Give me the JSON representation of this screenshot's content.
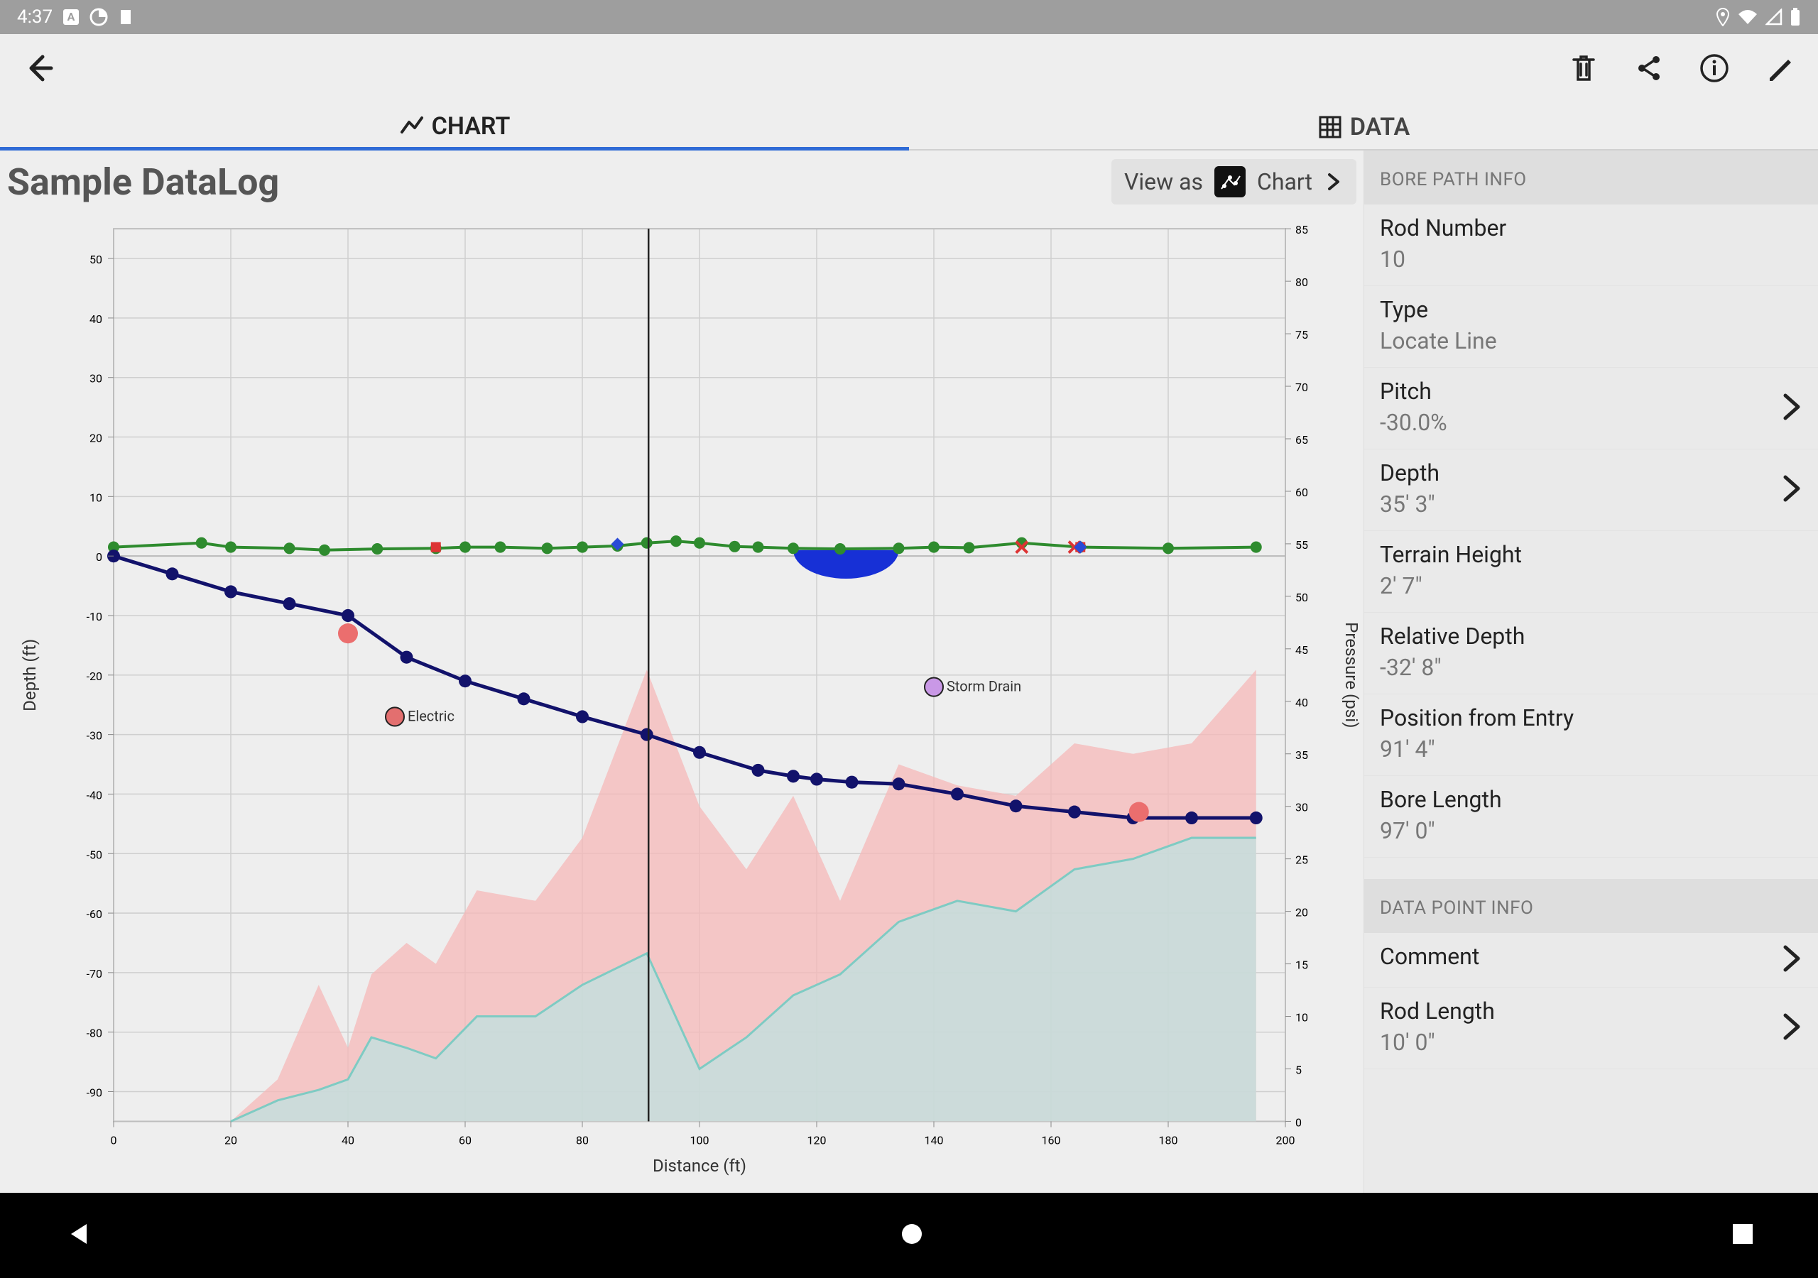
{
  "status": {
    "time": "4:37"
  },
  "tabs": {
    "chart": "CHART",
    "data": "DATA"
  },
  "title": "Sample DataLog",
  "view_as": {
    "label": "View as",
    "mode": "Chart"
  },
  "panel": {
    "section1": "BORE PATH INFO",
    "section2": "DATA POINT INFO",
    "rod_number": {
      "label": "Rod Number",
      "value": "10"
    },
    "type": {
      "label": "Type",
      "value": "Locate Line"
    },
    "pitch": {
      "label": "Pitch",
      "value": "-30.0%"
    },
    "depth": {
      "label": "Depth",
      "value": "35' 3\""
    },
    "terrain_height": {
      "label": "Terrain Height",
      "value": "2' 7\""
    },
    "relative_depth": {
      "label": "Relative Depth",
      "value": "-32' 8\""
    },
    "position": {
      "label": "Position from Entry",
      "value": "91' 4\""
    },
    "bore_length": {
      "label": "Bore Length",
      "value": "97' 0\""
    },
    "comment": {
      "label": "Comment",
      "value": ""
    },
    "rod_length": {
      "label": "Rod Length",
      "value": "10' 0\""
    }
  },
  "chart_data": {
    "type": "line",
    "xlabel": "Distance (ft)",
    "ylabel_left": "Depth (ft)",
    "ylabel_right": "Pressure (psi)",
    "xlim": [
      0,
      200
    ],
    "ylim_left": [
      -95,
      55
    ],
    "ylim_right": [
      0,
      85
    ],
    "x_ticks": [
      0,
      20,
      40,
      60,
      80,
      100,
      120,
      140,
      160,
      180,
      200
    ],
    "y_ticks_left": [
      -90,
      -80,
      -70,
      -60,
      -50,
      -40,
      -30,
      -20,
      -10,
      0,
      10,
      20,
      30,
      40,
      50
    ],
    "y_ticks_right": [
      0,
      5,
      10,
      15,
      20,
      25,
      30,
      35,
      40,
      45,
      50,
      55,
      60,
      65,
      70,
      75,
      80,
      85
    ],
    "cursor_x": 91.3,
    "utilities": [
      {
        "name": "Electric",
        "x": 48,
        "y": -27,
        "color": "#e36f6f"
      },
      {
        "name": "Storm Drain",
        "x": 140,
        "y": -22,
        "color": "#c998e6"
      }
    ],
    "flags": [
      {
        "x": 40,
        "y": -13,
        "color": "#eb6e6e"
      },
      {
        "x": 175,
        "y": -43,
        "color": "#eb6e6e"
      }
    ],
    "markers": [
      {
        "kind": "blue-diamond",
        "x": 86,
        "y": 2
      },
      {
        "kind": "red-square",
        "x": 55,
        "y": 1.5
      },
      {
        "kind": "red-x",
        "x": 155,
        "y": 1.5
      },
      {
        "kind": "red-x",
        "x": 164,
        "y": 1.5
      },
      {
        "kind": "red-square",
        "x": 165,
        "y": 1.5
      },
      {
        "kind": "blue-diamond",
        "x": 165,
        "y": 1.5
      }
    ],
    "water_body": {
      "x0": 116,
      "x1": 134,
      "y_top": 1
    },
    "series": [
      {
        "name": "Terrain",
        "axis": "left",
        "style": "terrain",
        "x": [
          0,
          15,
          20,
          30,
          36,
          45,
          55,
          60,
          66,
          74,
          80,
          86,
          91,
          96,
          100,
          106,
          110,
          116,
          124,
          134,
          140,
          146,
          155,
          165,
          180,
          195
        ],
        "y": [
          1.5,
          2.2,
          1.5,
          1.3,
          1.0,
          1.2,
          1.3,
          1.5,
          1.5,
          1.3,
          1.5,
          1.7,
          2.2,
          2.5,
          2.2,
          1.6,
          1.5,
          1.3,
          1.2,
          1.3,
          1.5,
          1.4,
          2.2,
          1.5,
          1.3,
          1.5
        ]
      },
      {
        "name": "Bore Path",
        "axis": "left",
        "style": "bore",
        "x": [
          0,
          10,
          20,
          30,
          40,
          50,
          60,
          70,
          80,
          91,
          100,
          110,
          116,
          120,
          126,
          134,
          144,
          154,
          164,
          174,
          184,
          195
        ],
        "y": [
          0,
          -3,
          -6,
          -8,
          -10,
          -17,
          -21,
          -24,
          -27,
          -30,
          -33,
          -36,
          -37,
          -37.5,
          -38,
          -38.3,
          -40,
          -42,
          -43,
          -44,
          -44,
          -44
        ]
      },
      {
        "name": "Pressure Max",
        "axis": "right",
        "style": "area-max",
        "x": [
          20,
          28,
          35,
          40,
          44,
          50,
          55,
          62,
          72,
          80,
          91,
          100,
          108,
          116,
          124,
          134,
          144,
          154,
          164,
          174,
          184,
          195
        ],
        "y": [
          0,
          4,
          13,
          7,
          14,
          17,
          15,
          22,
          21,
          27,
          43,
          30,
          24,
          31,
          21,
          34,
          32,
          31,
          36,
          35,
          36,
          43
        ]
      },
      {
        "name": "Pressure Avg",
        "axis": "right",
        "style": "area-avg",
        "x": [
          20,
          28,
          35,
          40,
          44,
          50,
          55,
          62,
          72,
          80,
          91,
          100,
          108,
          116,
          124,
          134,
          144,
          154,
          164,
          174,
          184,
          195
        ],
        "y": [
          0,
          2,
          3,
          4,
          8,
          7,
          6,
          10,
          10,
          13,
          16,
          5,
          8,
          12,
          14,
          19,
          21,
          20,
          24,
          25,
          27,
          27
        ]
      }
    ]
  }
}
